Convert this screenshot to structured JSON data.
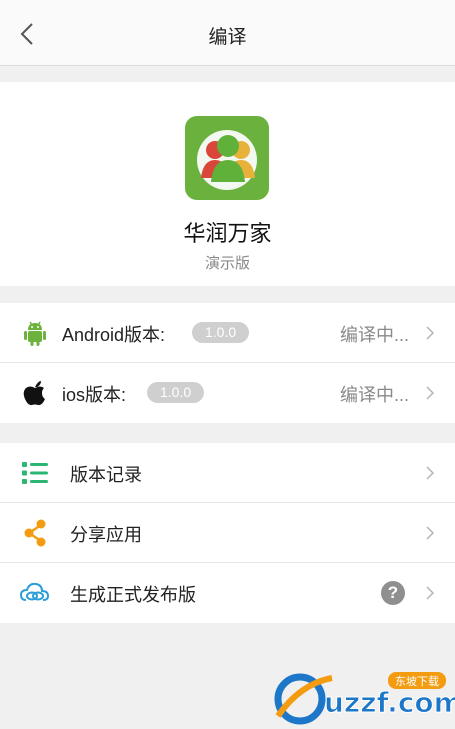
{
  "header": {
    "title": "编译"
  },
  "app": {
    "name": "华润万家",
    "edition": "演示版"
  },
  "platforms": [
    {
      "label": "Android版本:",
      "version": "1.0.0",
      "status": "编译中..."
    },
    {
      "label": "ios版本:",
      "version": "1.0.0",
      "status": "编译中..."
    }
  ],
  "actions": [
    {
      "label": "版本记录"
    },
    {
      "label": "分享应用"
    },
    {
      "label": "生成正式发布版",
      "help": "?"
    }
  ],
  "watermark": {
    "brand": "uzzf.com",
    "tag": "东坡下载"
  },
  "colors": {
    "android_green": "#6cb33e",
    "list_green": "#2bb673",
    "share_orange": "#f39c12",
    "cloud_blue": "#2a9fd8"
  }
}
